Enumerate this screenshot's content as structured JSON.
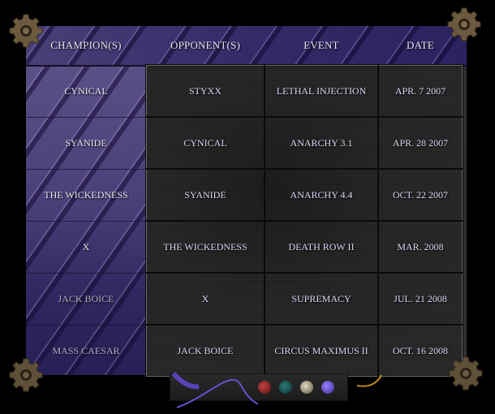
{
  "table": {
    "headers": [
      "CHAMPION(S)",
      "OPPONENT(S)",
      "EVENT",
      "DATE"
    ],
    "rows": [
      {
        "champion": "CYNICAL",
        "opponent": "STYXX",
        "event": "LETHAL INJECTION",
        "date": "APR. 7 2007"
      },
      {
        "champion": "SYANIDE",
        "opponent": "CYNICAL",
        "event": "ANARCHY 3.1",
        "date": "APR. 28 2007"
      },
      {
        "champion": "THE WICKEDNESS",
        "opponent": "SYANIDE",
        "event": "ANARCHY 4.4",
        "date": "OCT. 22 2007"
      },
      {
        "champion": "X",
        "opponent": "THE WICKEDNESS",
        "event": "DEATH ROW II",
        "date": "MAR. 2008"
      },
      {
        "champion": "JACK BOICE",
        "opponent": "X",
        "event": "SUPREMACY",
        "date": "JUL. 21 2008"
      },
      {
        "champion": "MASS CAESAR",
        "opponent": "JACK BOICE",
        "event": "CIRCUS MAXIMUS II",
        "date": "OCT. 16 2008"
      }
    ]
  },
  "decor": {
    "gear_icon": "gear-icon",
    "control_panel": {
      "lights": [
        {
          "name": "red-light",
          "color": "#8a1f22"
        },
        {
          "name": "teal-light",
          "color": "#0f4a4c"
        },
        {
          "name": "cream-light",
          "color": "#a89f88"
        },
        {
          "name": "violet-light",
          "color": "#6a4fd0"
        }
      ]
    }
  },
  "colors": {
    "accent_purple": "#4a3f78",
    "text_light": "#e6e6ee",
    "text_lavender": "#dcd6f5"
  }
}
